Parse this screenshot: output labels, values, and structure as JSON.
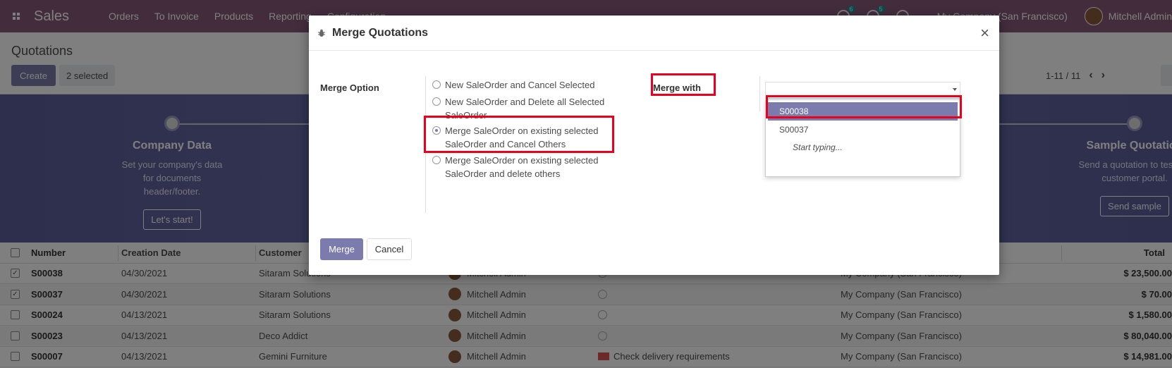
{
  "navbar": {
    "app_name": "Sales",
    "menu": [
      "Orders",
      "To Invoice",
      "Products",
      "Reporting",
      "Configuration"
    ],
    "activity_count": "6",
    "message_count": "5",
    "company": "My Company (San Francisco)",
    "user": "Mitchell Admin"
  },
  "control": {
    "breadcrumb": "Quotations",
    "create_label": "Create",
    "selected_label": "2 selected",
    "pager": "1-11 / 11"
  },
  "banner": {
    "steps": [
      {
        "title": "Company Data",
        "desc": "Set your company's data for documents header/footer.",
        "button": "Let's start!"
      },
      {
        "title": "Sample Quotation",
        "desc": "Send a quotation to test the customer portal.",
        "button": "Send sample"
      }
    ]
  },
  "table": {
    "headers": {
      "number": "Number",
      "date": "Creation Date",
      "customer": "Customer",
      "total": "Total"
    },
    "rows": [
      {
        "checked": true,
        "number": "S00038",
        "date": "04/30/2021",
        "customer": "Sitaram Solutions",
        "salesperson": "Mitchell Admin",
        "activity": "",
        "company": "My Company (San Francisco)",
        "total": "$ 23,500.00"
      },
      {
        "checked": true,
        "number": "S00037",
        "date": "04/30/2021",
        "customer": "Sitaram Solutions",
        "salesperson": "Mitchell Admin",
        "activity": "",
        "company": "My Company (San Francisco)",
        "total": "$ 70.00"
      },
      {
        "checked": false,
        "number": "S00024",
        "date": "04/13/2021",
        "customer": "Sitaram Solutions",
        "salesperson": "Mitchell Admin",
        "activity": "",
        "company": "My Company (San Francisco)",
        "total": "$ 1,580.00"
      },
      {
        "checked": false,
        "number": "S00023",
        "date": "04/13/2021",
        "customer": "Deco Addict",
        "salesperson": "Mitchell Admin",
        "activity": "",
        "company": "My Company (San Francisco)",
        "total": "$ 80,040.00"
      },
      {
        "checked": false,
        "number": "S00007",
        "date": "04/13/2021",
        "customer": "Gemini Furniture",
        "salesperson": "Mitchell Admin",
        "activity": "Check delivery requirements",
        "company": "My Company (San Francisco)",
        "total": "$ 14,981.00"
      }
    ]
  },
  "modal": {
    "title": "Merge Quotations",
    "close_glyph": "×",
    "merge_option_label": "Merge Option",
    "options": [
      {
        "label": "New SaleOrder and Cancel Selected",
        "checked": false
      },
      {
        "label": "New SaleOrder and Delete all Selected SaleOrder",
        "checked": false
      },
      {
        "label": "Merge SaleOrder on existing selected SaleOrder and Cancel Others",
        "checked": true
      },
      {
        "label": "Merge SaleOrder on existing selected SaleOrder and delete others",
        "checked": false
      }
    ],
    "merge_with_label": "Merge with",
    "merge_with_value": "",
    "dropdown_items": [
      "S00038",
      "S00037"
    ],
    "dropdown_hint": "Start typing...",
    "merge_button": "Merge",
    "cancel_button": "Cancel"
  },
  "colors": {
    "brand": "#875a7b",
    "primary": "#7c7bad",
    "highlight": "#e8001c"
  }
}
